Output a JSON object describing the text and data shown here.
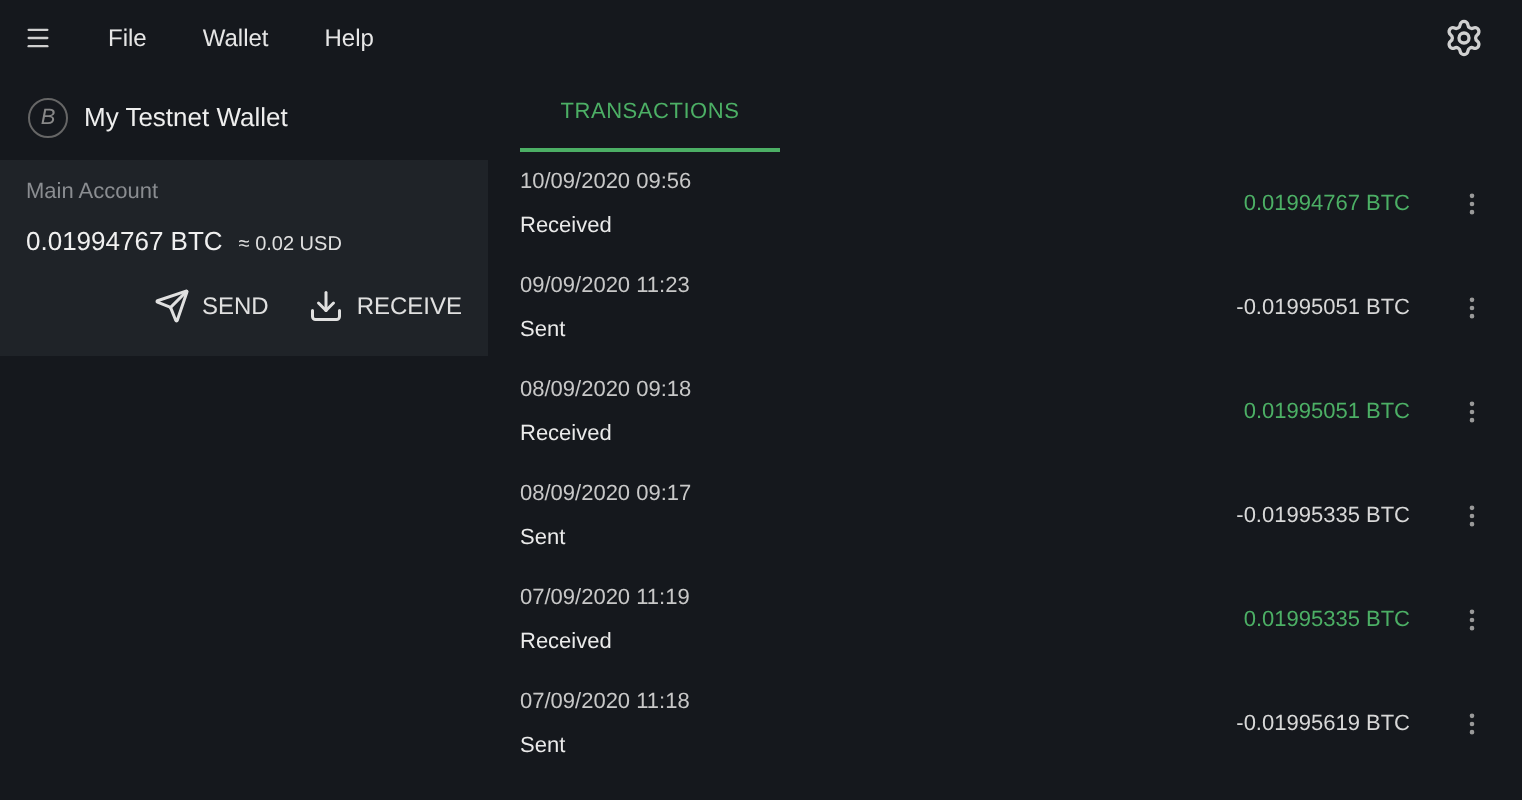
{
  "menu_bar": {
    "items": [
      "File",
      "Wallet",
      "Help"
    ]
  },
  "wallet": {
    "name": "My Testnet Wallet",
    "coin_symbol": "B"
  },
  "account": {
    "name": "Main Account",
    "balance": "0.01994767 BTC",
    "fiat": "≈ 0.02 USD",
    "actions": [
      "SEND",
      "RECEIVE"
    ]
  },
  "tabs": [
    {
      "label": "TRANSACTIONS",
      "selected": true
    }
  ],
  "transactions": [
    {
      "date": "10/09/2020 09:56",
      "type": "Received",
      "kind": "received",
      "amount": "0.01994767 BTC"
    },
    {
      "date": "09/09/2020 11:23",
      "type": "Sent",
      "kind": "sent",
      "amount": "-0.01995051 BTC"
    },
    {
      "date": "08/09/2020 09:18",
      "type": "Received",
      "kind": "received",
      "amount": "0.01995051 BTC"
    },
    {
      "date": "08/09/2020 09:17",
      "type": "Sent",
      "kind": "sent",
      "amount": "-0.01995335 BTC"
    },
    {
      "date": "07/09/2020 11:19",
      "type": "Received",
      "kind": "received",
      "amount": "0.01995335 BTC"
    },
    {
      "date": "07/09/2020 11:18",
      "type": "Sent",
      "kind": "sent",
      "amount": "-0.01995619 BTC"
    }
  ]
}
